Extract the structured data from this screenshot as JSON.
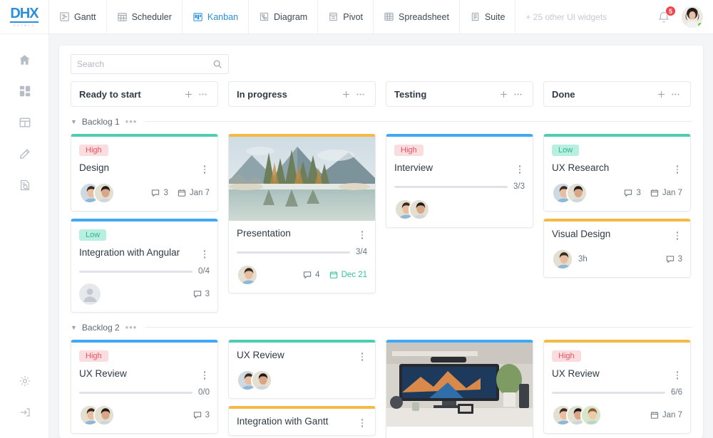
{
  "app": {
    "logo_text": "DHX",
    "logo_sub": "DHTMLX"
  },
  "header": {
    "tabs": [
      {
        "label": "Gantt",
        "icon": "gantt-icon",
        "active": false
      },
      {
        "label": "Scheduler",
        "icon": "scheduler-icon",
        "active": false
      },
      {
        "label": "Kanban",
        "icon": "kanban-icon",
        "active": true
      },
      {
        "label": "Diagram",
        "icon": "diagram-icon",
        "active": false
      },
      {
        "label": "Pivot",
        "icon": "pivot-icon",
        "active": false
      },
      {
        "label": "Spreadsheet",
        "icon": "spreadsheet-icon",
        "active": false
      },
      {
        "label": "Suite",
        "icon": "suite-icon",
        "active": false
      }
    ],
    "more_widgets_label": "+ 25 other UI widgets",
    "notifications": {
      "icon": "bell-icon",
      "count": "5",
      "badge_color": "#f1444b"
    },
    "user_avatar": {
      "icon": "avatar",
      "online": true,
      "status_color": "#52c41a"
    }
  },
  "sidebar": {
    "top_items": [
      {
        "icon": "home-icon",
        "name": "home"
      },
      {
        "icon": "dashboard-icon",
        "name": "dashboard"
      },
      {
        "icon": "table-icon",
        "name": "table"
      },
      {
        "icon": "pencil-icon",
        "name": "edit"
      },
      {
        "icon": "document-search-icon",
        "name": "reports"
      }
    ],
    "bottom_items": [
      {
        "icon": "gear-icon",
        "name": "settings"
      },
      {
        "icon": "logout-icon",
        "name": "logout"
      }
    ]
  },
  "search": {
    "placeholder": "Search",
    "value": "",
    "icon": "search-icon"
  },
  "columns": [
    {
      "title": "Ready to start",
      "add_icon": "plus-icon",
      "menu_icon": "ellipsis-icon"
    },
    {
      "title": "In progress",
      "add_icon": "plus-icon",
      "menu_icon": "ellipsis-icon"
    },
    {
      "title": "Testing",
      "add_icon": "plus-icon",
      "menu_icon": "ellipsis-icon"
    },
    {
      "title": "Done",
      "add_icon": "plus-icon",
      "menu_icon": "ellipsis-icon"
    }
  ],
  "colors": {
    "accent_blue": "#2b8fe0",
    "border_green": "#4ecdb4",
    "border_blue": "#3fa9f5",
    "border_orange": "#f5b945",
    "progress_blue": "#3b82ea",
    "high_badge_bg": "#fbdde0",
    "high_badge_text": "#e8535f",
    "low_badge_bg": "#b8efe0",
    "low_badge_text": "#2fb489",
    "date_green": "#2fc39b",
    "board_bg": "#f4f5f7"
  },
  "swimlanes": [
    {
      "name": "Backlog 1",
      "caret_icon": "caret-down-icon",
      "menu_icon": "ellipsis-icon",
      "cards": [
        [
          {
            "title": "Design",
            "badge": "High",
            "badge_type": "high",
            "accent": "green",
            "avatars": 2,
            "avatar_style": "pair-a",
            "comments": "3",
            "date": "Jan 7",
            "date_green": false
          },
          {
            "title": "Integration with Angular",
            "badge": "Low",
            "badge_type": "low",
            "accent": "blue",
            "progress_label": "0/4",
            "progress_pct": 0,
            "avatars": 0,
            "avatar_style": "empty",
            "comments": "3"
          }
        ],
        [
          {
            "title": "Presentation",
            "accent": "orange",
            "image": "mountain-lake-photo",
            "progress_label": "3/4",
            "progress_pct": 75,
            "avatars": 1,
            "avatar_style": "single-woman",
            "comments": "4",
            "date": "Dec 21",
            "date_green": true
          }
        ],
        [
          {
            "title": "Interview",
            "badge": "High",
            "badge_type": "high",
            "accent": "blue",
            "progress_label": "3/3",
            "progress_pct": 100,
            "avatars": 2,
            "avatar_style": "pair-b",
            "comments": ""
          }
        ],
        [
          {
            "title": "UX Research",
            "badge": "Low",
            "badge_type": "low",
            "accent": "green",
            "avatars": 2,
            "avatar_style": "pair-a",
            "comments": "3",
            "date": "Jan 7",
            "date_green": false
          },
          {
            "title": "Visual Design",
            "accent": "orange",
            "avatars": 1,
            "avatar_style": "single-man",
            "hours": "3h",
            "comments": "3"
          }
        ]
      ]
    },
    {
      "name": "Backlog 2",
      "caret_icon": "caret-down-icon",
      "menu_icon": "ellipsis-icon",
      "cards": [
        [
          {
            "title": "UX Review",
            "badge": "High",
            "badge_type": "high",
            "accent": "blue",
            "progress_label": "0/0",
            "progress_pct": 0,
            "avatars": 2,
            "avatar_style": "pair-b",
            "comments": "3"
          }
        ],
        [
          {
            "title": "UX Review",
            "accent": "green",
            "avatars": 2,
            "avatar_style": "pair-a",
            "comments": ""
          },
          {
            "title": "Integration with Gantt",
            "accent": "orange"
          }
        ],
        [
          {
            "title": "",
            "accent": "blue",
            "image": "desk-monitor-photo"
          }
        ],
        [
          {
            "title": "UX Review",
            "badge": "High",
            "badge_type": "high",
            "accent": "orange",
            "progress_label": "6/6",
            "progress_pct": 100,
            "avatars": 3,
            "avatar_style": "trio",
            "date": "Jan 7",
            "date_green": false
          }
        ]
      ]
    }
  ]
}
